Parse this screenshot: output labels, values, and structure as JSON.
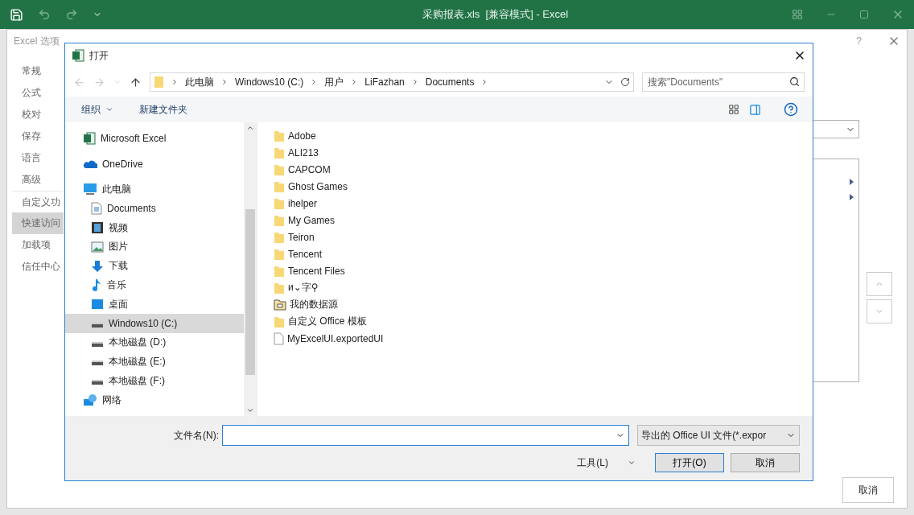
{
  "app": {
    "title": "采购报表.xls  [兼容模式] - Excel"
  },
  "options_dialog": {
    "title": "Excel 选项",
    "help": "?",
    "nav": [
      {
        "label": "常规",
        "selected": false
      },
      {
        "label": "公式",
        "selected": false
      },
      {
        "label": "校对",
        "selected": false
      },
      {
        "label": "保存",
        "selected": false
      },
      {
        "label": "语言",
        "selected": false
      },
      {
        "label": "高级",
        "selected": false
      },
      {
        "label": "自定义功",
        "selected": false
      },
      {
        "label": "快速访问",
        "selected": true
      },
      {
        "label": "加载项",
        "selected": false
      },
      {
        "label": "信任中心",
        "selected": false
      }
    ],
    "cancel": "取消"
  },
  "open_dialog": {
    "title": "打开",
    "breadcrumb": [
      "此电脑",
      "Windows10 (C:)",
      "用户",
      "LiFazhan",
      "Documents"
    ],
    "search": {
      "placeholder": "搜索\"Documents\""
    },
    "organize": "组织",
    "new_folder": "新建文件夹",
    "nav": [
      {
        "label": "Microsoft Excel",
        "kind": "excel",
        "selected": false
      },
      {
        "label": "OneDrive",
        "kind": "cloud",
        "selected": false
      },
      {
        "label": "此电脑",
        "kind": "pc",
        "selected": false,
        "children": [
          {
            "label": "Documents",
            "kind": "docs",
            "selected": false
          },
          {
            "label": "视频",
            "kind": "video",
            "selected": false
          },
          {
            "label": "图片",
            "kind": "pictures",
            "selected": false
          },
          {
            "label": "下载",
            "kind": "download",
            "selected": false
          },
          {
            "label": "音乐",
            "kind": "music",
            "selected": false
          },
          {
            "label": "桌面",
            "kind": "desktop",
            "selected": false
          },
          {
            "label": "Windows10 (C:)",
            "kind": "drive",
            "selected": true
          },
          {
            "label": "本地磁盘 (D:)",
            "kind": "drive",
            "selected": false
          },
          {
            "label": "本地磁盘 (E:)",
            "kind": "drive",
            "selected": false
          },
          {
            "label": "本地磁盘 (F:)",
            "kind": "drive",
            "selected": false
          }
        ]
      },
      {
        "label": "网络",
        "kind": "network",
        "selected": false
      }
    ],
    "files": [
      {
        "name": "Adobe",
        "kind": "folder"
      },
      {
        "name": "ALI213",
        "kind": "folder"
      },
      {
        "name": "CAPCOM",
        "kind": "folder"
      },
      {
        "name": "Ghost Games",
        "kind": "folder"
      },
      {
        "name": "ihelper",
        "kind": "folder"
      },
      {
        "name": "My Games",
        "kind": "folder"
      },
      {
        "name": "Teiron",
        "kind": "folder"
      },
      {
        "name": "Tencent",
        "kind": "folder"
      },
      {
        "name": "Tencent Files",
        "kind": "folder"
      },
      {
        "name": "и⌄字⚲",
        "kind": "folder"
      },
      {
        "name": "我的数据源",
        "kind": "datasource"
      },
      {
        "name": "自定义 Office 模板",
        "kind": "folder"
      },
      {
        "name": "MyExcelUI.exportedUI",
        "kind": "file"
      }
    ],
    "filename_label": "文件名(N):",
    "filetype": "导出的 Office UI 文件(*.expor",
    "tools": "工具(L)",
    "open": "打开(O)",
    "cancel": "取消"
  }
}
